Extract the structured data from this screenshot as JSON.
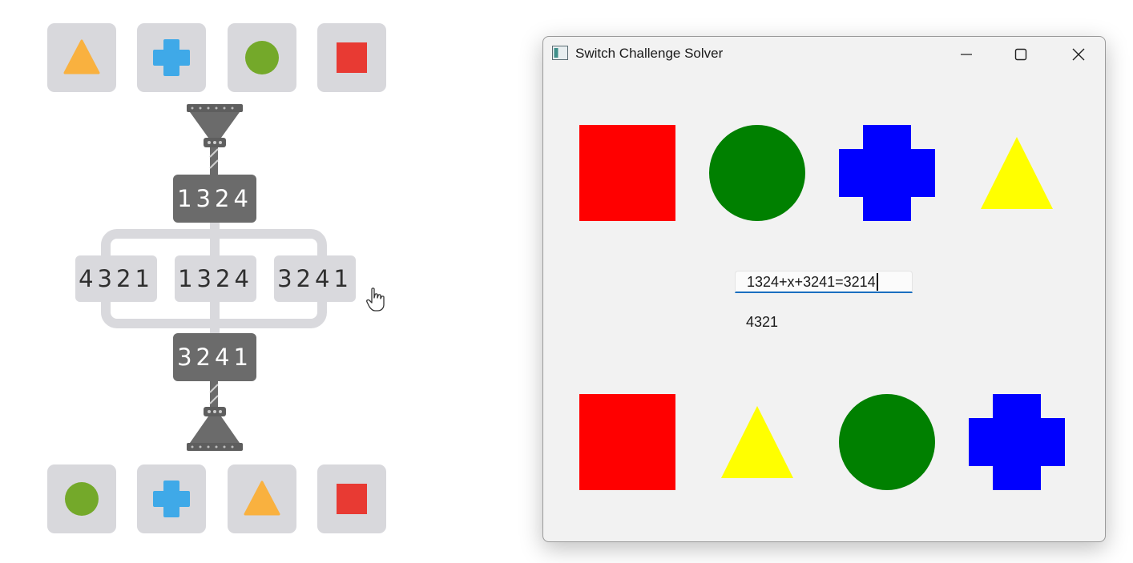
{
  "puzzle": {
    "top_shapes": [
      "triangle",
      "plus",
      "circle",
      "square"
    ],
    "top_shape_icons": [
      "triangle-icon",
      "plus-icon",
      "circle-icon",
      "square-icon"
    ],
    "input_code": "1324",
    "options": [
      "4321",
      "1324",
      "3241"
    ],
    "output_code": "3241",
    "bottom_shapes": [
      "circle",
      "plus",
      "triangle",
      "square"
    ],
    "colors": {
      "tile": "#d8d8dc",
      "triangle": "#f9b13f",
      "plus": "#3fa9e8",
      "circle": "#74a92a",
      "square": "#e83a33",
      "machine": "#6b6b6b"
    }
  },
  "window": {
    "title": "Switch Challenge Solver",
    "app_icon": "app-window-icon",
    "controls": [
      "minimize-icon",
      "maximize-icon",
      "close-icon"
    ],
    "top_shapes": [
      "square",
      "circle",
      "plus",
      "triangle"
    ],
    "equation_value": "1324+x+3241=3214",
    "result": "4321",
    "bottom_shapes": [
      "square",
      "triangle",
      "circle",
      "plus"
    ],
    "colors": {
      "square": "#ff0000",
      "circle": "#008000",
      "plus": "#0000ff",
      "triangle": "#ffff00",
      "background": "#f2f2f2",
      "input_underline": "#1a6fc0"
    }
  }
}
